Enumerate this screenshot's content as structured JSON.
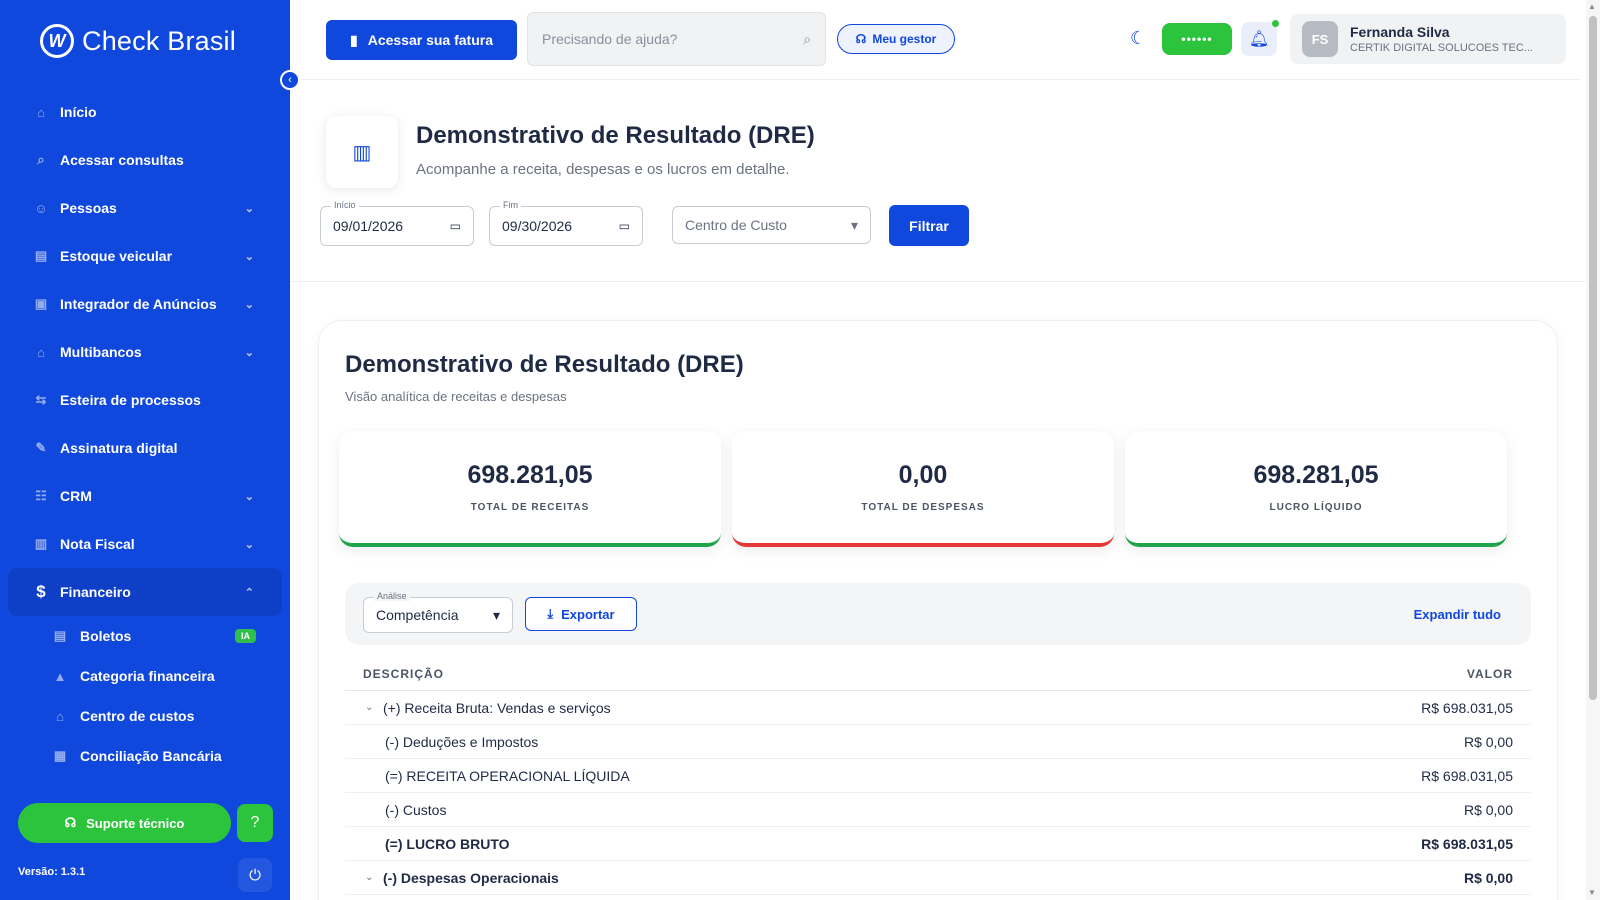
{
  "sidebar": {
    "brand": "Check Brasil",
    "items": [
      {
        "label": "Início",
        "icon": "home-icon",
        "has_children": false
      },
      {
        "label": "Acessar consultas",
        "icon": "search-icon",
        "has_children": false
      },
      {
        "label": "Pessoas",
        "icon": "people-icon",
        "has_children": true
      },
      {
        "label": "Estoque veicular",
        "icon": "car-icon",
        "has_children": true
      },
      {
        "label": "Integrador de Anúncios",
        "icon": "ads-icon",
        "has_children": true
      },
      {
        "label": "Multibancos",
        "icon": "bank-icon",
        "has_children": true
      },
      {
        "label": "Esteira de processos",
        "icon": "flow-icon",
        "has_children": false
      },
      {
        "label": "Assinatura digital",
        "icon": "signature-icon",
        "has_children": false
      },
      {
        "label": "CRM",
        "icon": "crm-icon",
        "has_children": true
      },
      {
        "label": "Nota Fiscal",
        "icon": "invoice-icon",
        "has_children": true
      },
      {
        "label": "Financeiro",
        "icon": "finance-icon",
        "has_children": true,
        "expanded": true
      }
    ],
    "sub_items": [
      {
        "label": "Boletos",
        "icon": "boleto-icon",
        "badge": "IA"
      },
      {
        "label": "Categoria financeira",
        "icon": "category-icon"
      },
      {
        "label": "Centro de custos",
        "icon": "bank-icon"
      },
      {
        "label": "Conciliação Bancária",
        "icon": "reconcile-icon"
      }
    ],
    "support_label": "Suporte técnico",
    "version": "Versão: 1.3.1"
  },
  "topbar": {
    "fatura_label": "Acessar sua fatura",
    "search_placeholder": "Precisando de ajuda?",
    "gestor_label": "Meu gestor",
    "masked_pill": "••••••",
    "user": {
      "initials": "FS",
      "name": "Fernanda Silva",
      "company": "CERTIK DIGITAL SOLUCOES TEC..."
    }
  },
  "header": {
    "title": "Demonstrativo de Resultado (DRE)",
    "subtitle": "Acompanhe a receita, despesas e os lucros em detalhe.",
    "start_caption": "Início",
    "start_date": "09/01/2026",
    "end_caption": "Fim",
    "end_date": "09/30/2026",
    "cost_center_placeholder": "Centro de Custo",
    "filter_label": "Filtrar"
  },
  "card": {
    "title": "Demonstrativo de Resultado (DRE)",
    "subtitle": "Visão analítica de receitas e despesas",
    "kpis": [
      {
        "value": "698.281,05",
        "caption": "TOTAL DE RECEITAS",
        "accent": "#1fa44c"
      },
      {
        "value": "0,00",
        "caption": "TOTAL DE DESPESAS",
        "accent": "#e53935"
      },
      {
        "value": "698.281,05",
        "caption": "LUCRO LÍQUIDO",
        "accent": "#1fa44c"
      }
    ],
    "analise_caption": "Análise",
    "analise_value": "Competência",
    "export_label": "Exportar",
    "expand_label": "Expandir tudo",
    "table": {
      "headers": [
        "DESCRIÇÃO",
        "VALOR"
      ],
      "rows": [
        {
          "desc": "(+) Receita Bruta: Vendas e serviços",
          "value": "R$ 698.031,05",
          "expandable": true,
          "bold": false
        },
        {
          "desc": "(-) Deduções e Impostos",
          "value": "R$ 0,00",
          "expandable": false,
          "bold": false
        },
        {
          "desc": "(=) RECEITA OPERACIONAL LÍQUIDA",
          "value": "R$ 698.031,05",
          "expandable": false,
          "bold": false
        },
        {
          "desc": "(-) Custos",
          "value": "R$ 0,00",
          "expandable": false,
          "bold": false
        },
        {
          "desc": "(=) LUCRO BRUTO",
          "value": "R$ 698.031,05",
          "expandable": false,
          "bold": true
        },
        {
          "desc": "(-) Despesas Operacionais",
          "value": "R$ 0,00",
          "expandable": true,
          "bold": true
        }
      ]
    }
  },
  "colors": {
    "primary": "#1047dc",
    "success": "#2bc43c",
    "danger": "#e53935"
  }
}
